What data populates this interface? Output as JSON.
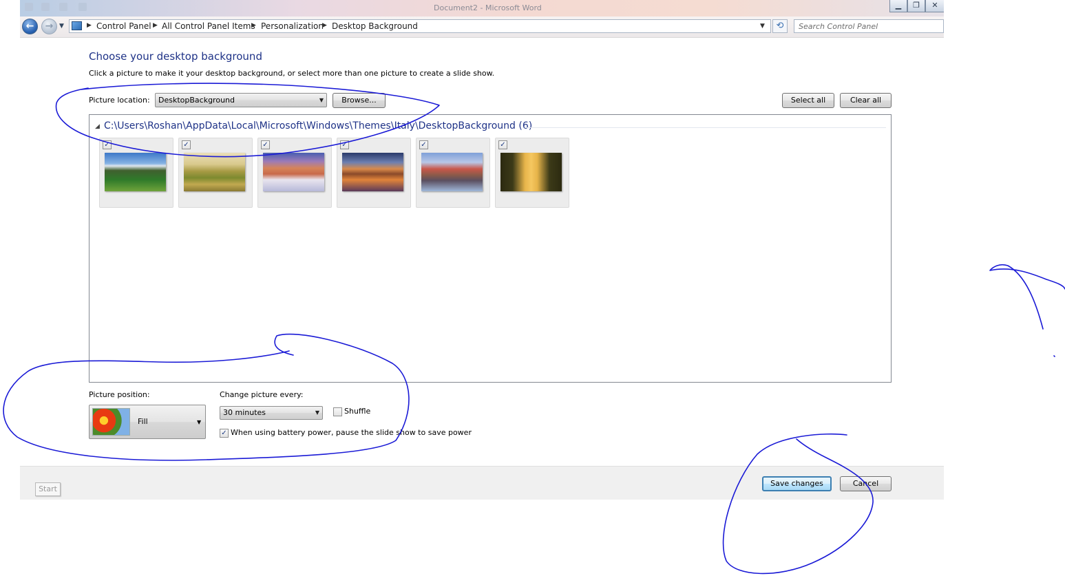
{
  "window": {
    "title": "Document2 - Microsoft Word",
    "controls": {
      "minimize": "▁",
      "restore": "❐",
      "close": "✕"
    }
  },
  "nav": {
    "back_icon": "back-arrow-icon",
    "forward_icon": "forward-arrow-icon",
    "breadcrumbs": [
      "Control Panel",
      "All Control Panel Items",
      "Personalization",
      "Desktop Background"
    ],
    "search_placeholder": "Search Control Panel"
  },
  "page": {
    "heading": "Choose your desktop background",
    "subtext": "Click a picture to make it your desktop background, or select more than one picture to create a slide show.",
    "picture_location_label": "Picture location:",
    "picture_location_value": "DesktopBackground",
    "browse_label": "Browse...",
    "select_all_label": "Select all",
    "clear_all_label": "Clear all",
    "group_header": "C:\\Users\\Roshan\\AppData\\Local\\Microsoft\\Windows\\Themes\\Italy\\DesktopBackground (6)",
    "pictures": [
      {
        "checked": true,
        "theme": "mountain-meadow"
      },
      {
        "checked": true,
        "theme": "tuscan-hills"
      },
      {
        "checked": true,
        "theme": "snowy-dolomites"
      },
      {
        "checked": true,
        "theme": "bridge-sunset"
      },
      {
        "checked": true,
        "theme": "cliff-village"
      },
      {
        "checked": true,
        "theme": "cypress-road"
      }
    ],
    "picture_position_label": "Picture position:",
    "picture_position_value": "Fill",
    "change_every_label": "Change picture every:",
    "change_every_value": "30 minutes",
    "shuffle_label": "Shuffle",
    "shuffle_checked": false,
    "battery_label": "When using battery power, pause the slide show to save power",
    "battery_checked": true
  },
  "footer": {
    "save_label": "Save changes",
    "cancel_label": "Cancel",
    "start_label": "Start"
  },
  "colors": {
    "heading": "#1e3287",
    "annotation_ink": "#1a1ad6",
    "focus_button": "#3c7fb1"
  }
}
